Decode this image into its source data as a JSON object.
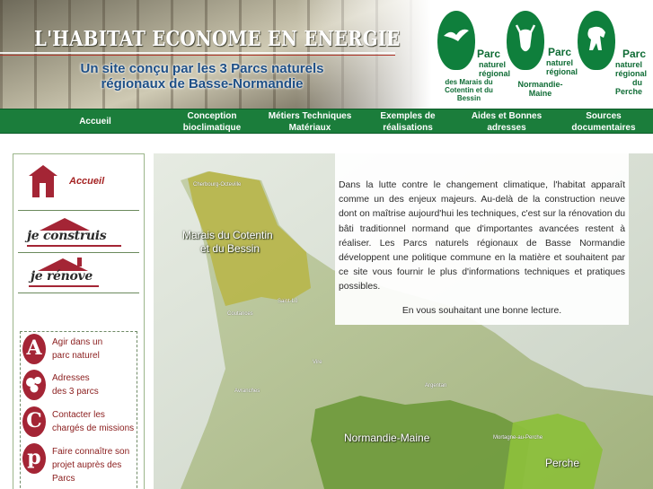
{
  "header": {
    "title": "L'HABITAT ECONOME EN ENERGIE",
    "subtitle_line1": "Un site conçu par les 3 Parcs naturels",
    "subtitle_line2": "régionaux de Basse-Normandie",
    "parks": [
      {
        "word": "Parc",
        "lines": [
          "naturel",
          "régional",
          "des Marais du",
          "Cotentin et du Bessin"
        ]
      },
      {
        "word": "Parc",
        "lines": [
          "naturel",
          "régional",
          "Normandie-Maine"
        ]
      },
      {
        "word": "Parc",
        "lines": [
          "naturel",
          "régional",
          "du Perche"
        ]
      }
    ]
  },
  "nav": {
    "items": [
      {
        "line1": "Accueil",
        "line2": ""
      },
      {
        "line1": "Conception",
        "line2": "bioclimatique"
      },
      {
        "line1": "Métiers Techniques",
        "line2": "Matériaux"
      },
      {
        "line1": "Exemples de",
        "line2": "réalisations"
      },
      {
        "line1": "Aides et Bonnes",
        "line2": "adresses"
      },
      {
        "line1": "Sources",
        "line2": "documentaires"
      }
    ]
  },
  "sidebar": {
    "accueil": "Accueil",
    "construis": "je construis",
    "renove": "je rénove",
    "sub_items": [
      {
        "letter": "A",
        "line1": "Agir dans un",
        "line2": "parc naturel"
      },
      {
        "letter": "",
        "line1": "Adresses",
        "line2": "des 3 parcs"
      },
      {
        "letter": "C",
        "line1": "Contacter les",
        "line2": "chargés de missions"
      },
      {
        "letter": "p",
        "line1": "Faire connaître son",
        "line2": "projet auprès des",
        "line3": "Parcs"
      }
    ]
  },
  "map": {
    "regions": {
      "cotentin_line1": "Marais du Cotentin",
      "cotentin_line2": "et du Bessin",
      "normandie_maine": "Normandie-Maine",
      "perche": "Perche"
    },
    "towns": [
      "Cherbourg-Octeville",
      "Coutances",
      "Saint-Lô",
      "Vire",
      "Avranches",
      "Argentan",
      "Mortagne-au-Perche"
    ]
  },
  "intro": {
    "body": "Dans la lutte contre le changement climatique, l'habitat apparaît comme un des enjeux majeurs. Au-delà de la construction neuve dont on maîtrise aujourd'hui les techniques, c'est sur la rénovation du bâti traditionnel normand que d'importantes avancées restent à réaliser. Les Parcs naturels régionaux de Basse Normandie développent une politique commune en la matière et souhaitent par ce site vous fournir le plus d'informations techniques et pratiques possibles.",
    "closing": "En vous souhaitant une bonne lecture."
  },
  "colors": {
    "nav_green": "#1b7d3b",
    "park_green": "#0f7f3c",
    "accent_red": "#a42535",
    "subtitle_blue": "#1e4f86"
  }
}
